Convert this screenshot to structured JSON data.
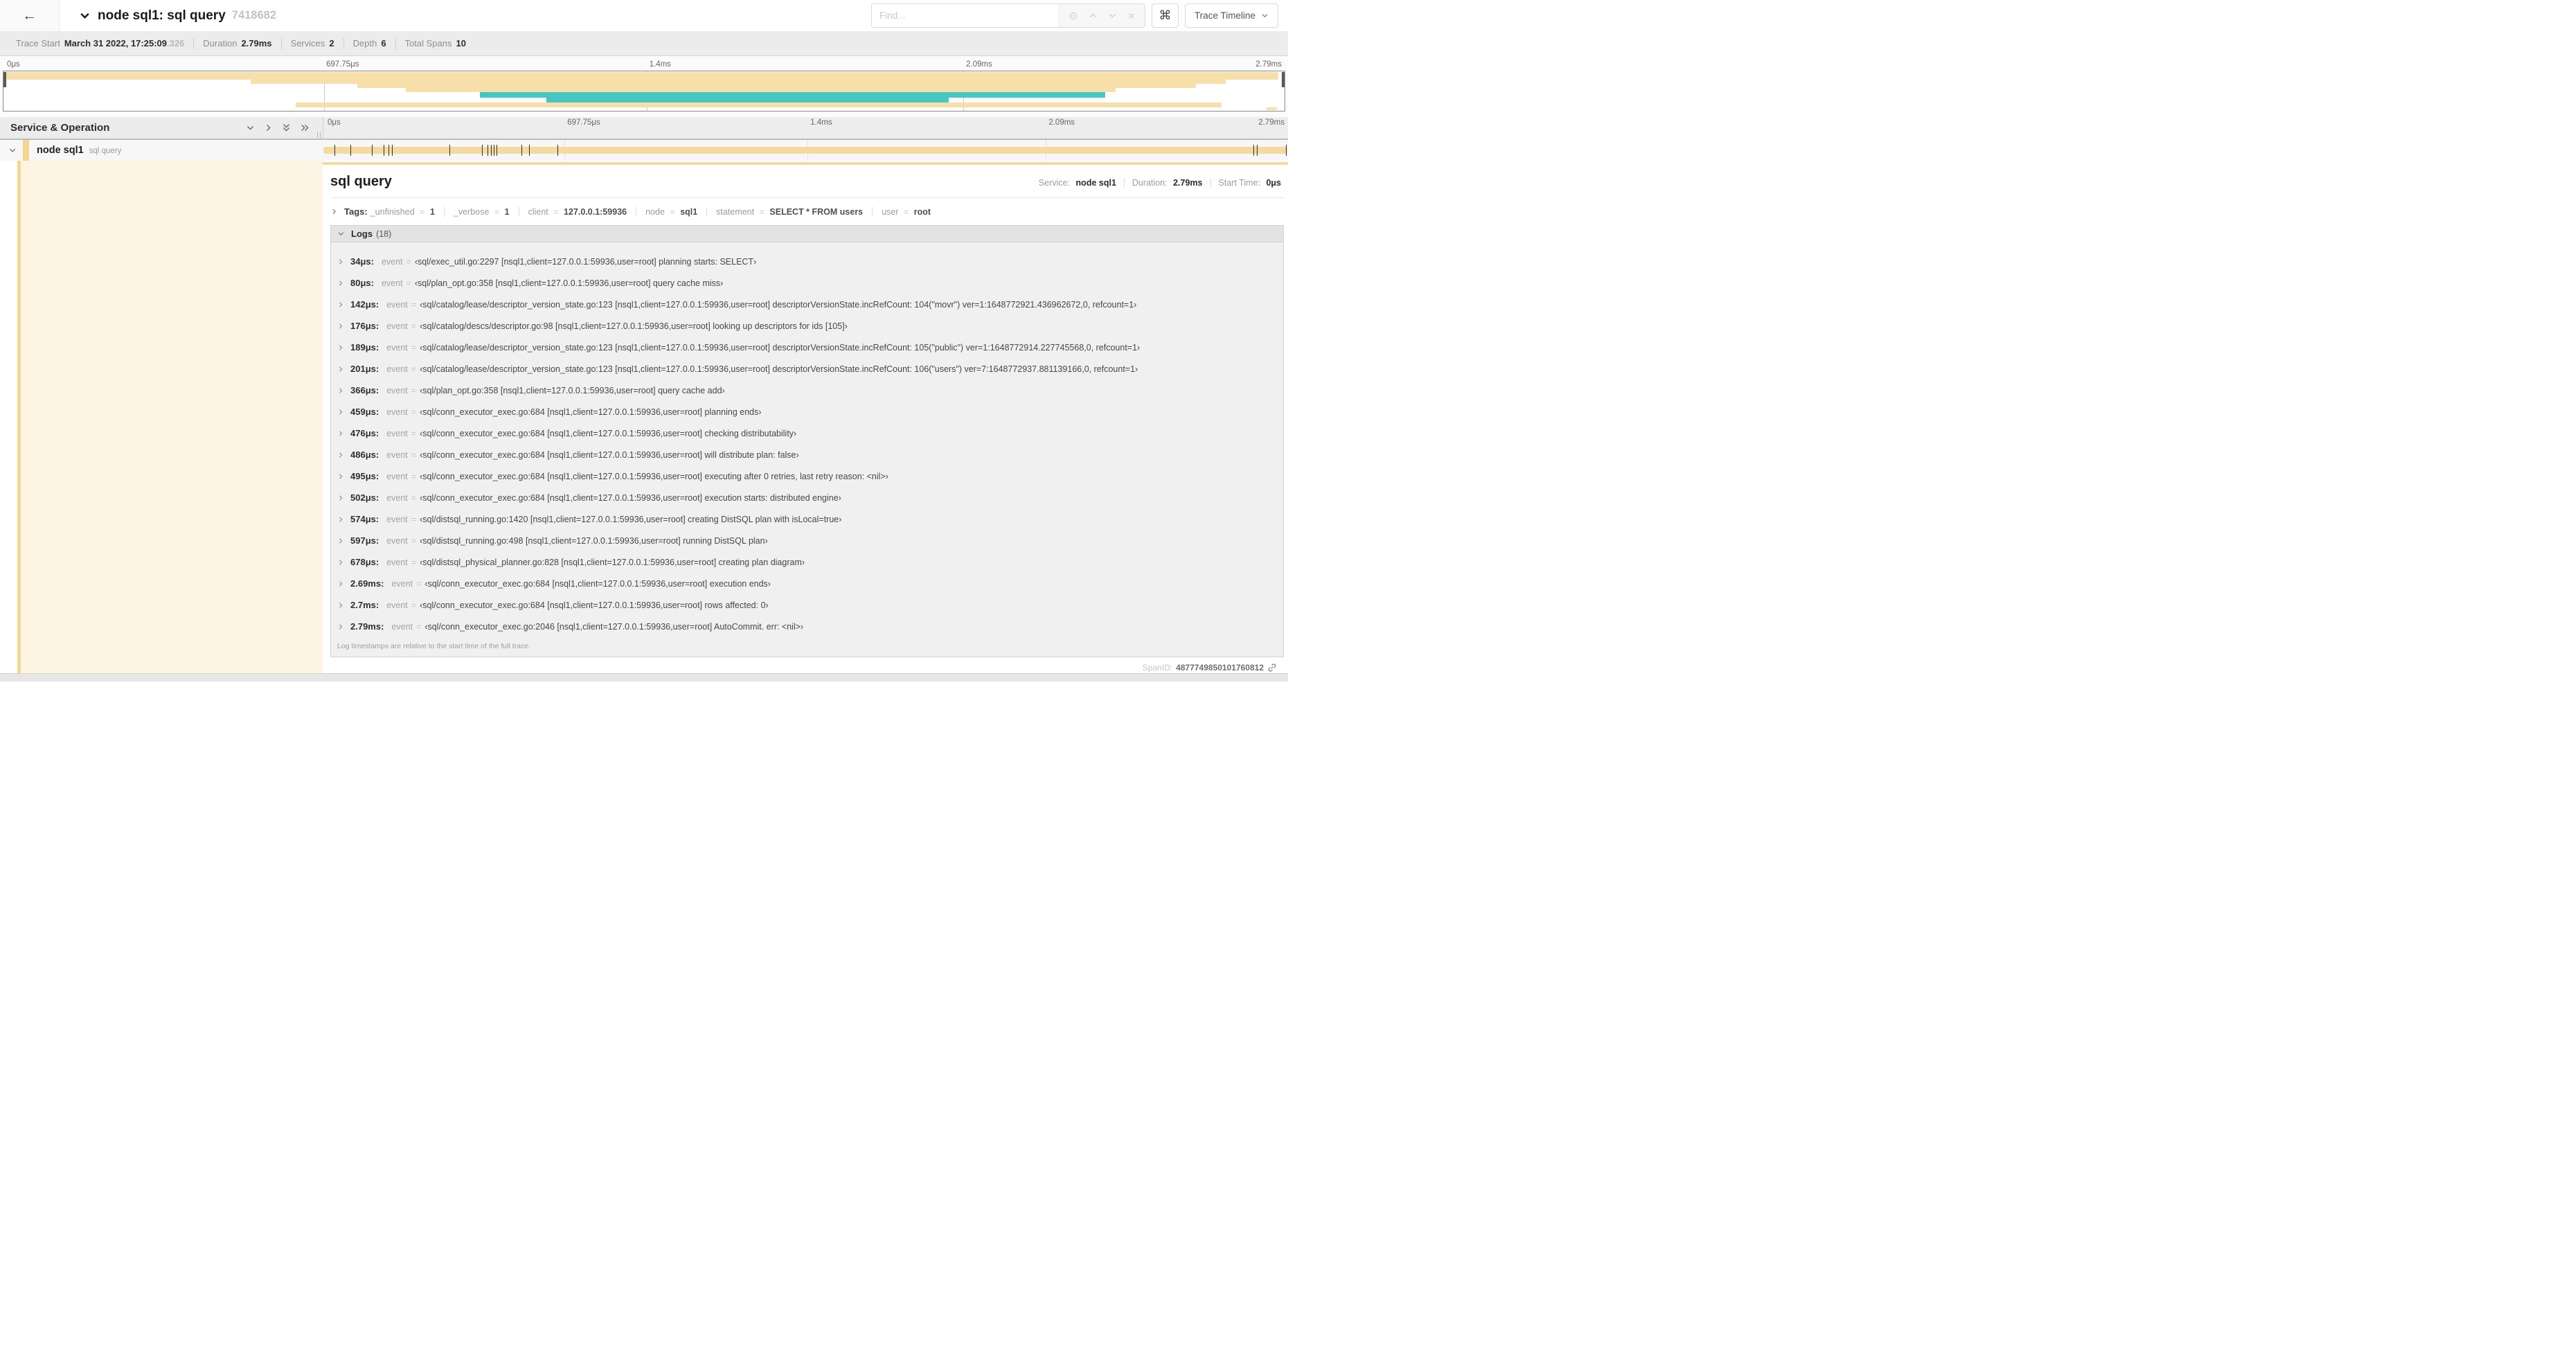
{
  "header": {
    "back_icon": "arrow-left",
    "collapse_icon": "chevron-down",
    "title": "node sql1: sql query",
    "trace_id": "7418682",
    "find_placeholder": "Find...",
    "shortcut_label": "⌘",
    "view_button_label": "Trace Timeline"
  },
  "summary": {
    "items": [
      {
        "label": "Trace Start",
        "value": "March 31 2022, 17:25:09",
        "suffix": ".326"
      },
      {
        "label": "Duration",
        "value": "2.79ms",
        "suffix": ""
      },
      {
        "label": "Services",
        "value": "2",
        "suffix": ""
      },
      {
        "label": "Depth",
        "value": "6",
        "suffix": ""
      },
      {
        "label": "Total Spans",
        "value": "10",
        "suffix": ""
      }
    ]
  },
  "timeline": {
    "ticks": [
      {
        "label": "0μs",
        "pos": 0
      },
      {
        "label": "697.75μs",
        "pos": 25
      },
      {
        "label": "1.4ms",
        "pos": 50.2
      },
      {
        "label": "2.09ms",
        "pos": 74.9
      },
      {
        "label": "2.79ms",
        "pos": 100
      }
    ],
    "gridline_positions": [
      25,
      50.2,
      74.9
    ],
    "colors": {
      "tan": "#f6dfa9",
      "teal": "#46c5c2"
    },
    "minimap_rows": [
      {
        "start": 0,
        "end": 99.5,
        "color": "tan",
        "h": 11
      },
      {
        "start": 19.3,
        "end": 95.4,
        "color": "tan",
        "h": 6
      },
      {
        "start": 27.6,
        "end": 93.1,
        "color": "tan",
        "h": 6
      },
      {
        "start": 31.4,
        "end": 86.8,
        "color": "tan",
        "h": 6
      },
      {
        "start": 37.2,
        "end": 86.0,
        "color": "teal",
        "h": 8
      },
      {
        "start": 42.4,
        "end": 73.8,
        "color": "teal",
        "h": 7
      },
      {
        "start": 22.8,
        "end": 95.1,
        "color": "tan",
        "h": 7
      },
      {
        "start": 98.6,
        "end": 99.4,
        "color": "tan",
        "h": 4
      }
    ]
  },
  "columns": {
    "left_title": "Service & Operation"
  },
  "span": {
    "service": "node sql1",
    "operation": "sql query",
    "log_ticks_pct": [
      1.2,
      2.9,
      5.1,
      6.3,
      6.8,
      7.2,
      13.1,
      16.5,
      17.1,
      17.4,
      17.7,
      18.0,
      20.6,
      21.4,
      24.3,
      96.4,
      96.8,
      99.8
    ]
  },
  "detail": {
    "title": "sql query",
    "meta": [
      {
        "label": "Service:",
        "value": "node sql1"
      },
      {
        "label": "Duration:",
        "value": "2.79ms"
      },
      {
        "label": "Start Time:",
        "value": "0μs"
      }
    ],
    "tags_label": "Tags:",
    "tags": [
      {
        "key": "_unfinished",
        "value": "1"
      },
      {
        "key": "_verbose",
        "value": "1"
      },
      {
        "key": "client",
        "value": "127.0.0.1:59936"
      },
      {
        "key": "node",
        "value": "sql1"
      },
      {
        "key": "statement",
        "value": "SELECT * FROM users"
      },
      {
        "key": "user",
        "value": "root"
      }
    ],
    "logs_label": "Logs",
    "logs_count": "(18)",
    "log_field": "event",
    "logs": [
      {
        "time": "34μs:",
        "value": "‹sql/exec_util.go:2297 [nsql1,client=127.0.0.1:59936,user=root] planning starts: SELECT›"
      },
      {
        "time": "80μs:",
        "value": "‹sql/plan_opt.go:358 [nsql1,client=127.0.0.1:59936,user=root] query cache miss›"
      },
      {
        "time": "142μs:",
        "value": "‹sql/catalog/lease/descriptor_version_state.go:123 [nsql1,client=127.0.0.1:59936,user=root] descriptorVersionState.incRefCount: 104(\"movr\") ver=1:1648772921.436962672,0, refcount=1›"
      },
      {
        "time": "176μs:",
        "value": "‹sql/catalog/descs/descriptor.go:98 [nsql1,client=127.0.0.1:59936,user=root] looking up descriptors for ids [105]›"
      },
      {
        "time": "189μs:",
        "value": "‹sql/catalog/lease/descriptor_version_state.go:123 [nsql1,client=127.0.0.1:59936,user=root] descriptorVersionState.incRefCount: 105(\"public\") ver=1:1648772914.227745568,0, refcount=1›"
      },
      {
        "time": "201μs:",
        "value": "‹sql/catalog/lease/descriptor_version_state.go:123 [nsql1,client=127.0.0.1:59936,user=root] descriptorVersionState.incRefCount: 106(\"users\") ver=7:1648772937.881139166,0, refcount=1›"
      },
      {
        "time": "366μs:",
        "value": "‹sql/plan_opt.go:358 [nsql1,client=127.0.0.1:59936,user=root] query cache add›"
      },
      {
        "time": "459μs:",
        "value": "‹sql/conn_executor_exec.go:684 [nsql1,client=127.0.0.1:59936,user=root] planning ends›"
      },
      {
        "time": "476μs:",
        "value": "‹sql/conn_executor_exec.go:684 [nsql1,client=127.0.0.1:59936,user=root] checking distributability›"
      },
      {
        "time": "486μs:",
        "value": "‹sql/conn_executor_exec.go:684 [nsql1,client=127.0.0.1:59936,user=root] will distribute plan: false›"
      },
      {
        "time": "495μs:",
        "value": "‹sql/conn_executor_exec.go:684 [nsql1,client=127.0.0.1:59936,user=root] executing after 0 retries, last retry reason: <nil>›"
      },
      {
        "time": "502μs:",
        "value": "‹sql/conn_executor_exec.go:684 [nsql1,client=127.0.0.1:59936,user=root] execution starts: distributed engine›"
      },
      {
        "time": "574μs:",
        "value": "‹sql/distsql_running.go:1420 [nsql1,client=127.0.0.1:59936,user=root] creating DistSQL plan with isLocal=true›"
      },
      {
        "time": "597μs:",
        "value": "‹sql/distsql_running.go:498 [nsql1,client=127.0.0.1:59936,user=root] running DistSQL plan›"
      },
      {
        "time": "678μs:",
        "value": "‹sql/distsql_physical_planner.go:828 [nsql1,client=127.0.0.1:59936,user=root] creating plan diagram›"
      },
      {
        "time": "2.69ms:",
        "value": "‹sql/conn_executor_exec.go:684 [nsql1,client=127.0.0.1:59936,user=root] execution ends›"
      },
      {
        "time": "2.7ms:",
        "value": "‹sql/conn_executor_exec.go:684 [nsql1,client=127.0.0.1:59936,user=root] rows affected: 0›"
      },
      {
        "time": "2.79ms:",
        "value": "‹sql/conn_executor_exec.go:2046 [nsql1,client=127.0.0.1:59936,user=root] AutoCommit. err: <nil>›"
      }
    ],
    "note": "Log timestamps are relative to the start time of the full trace.",
    "footer": {
      "label": "SpanID:",
      "value": "4877749850101760812"
    }
  }
}
